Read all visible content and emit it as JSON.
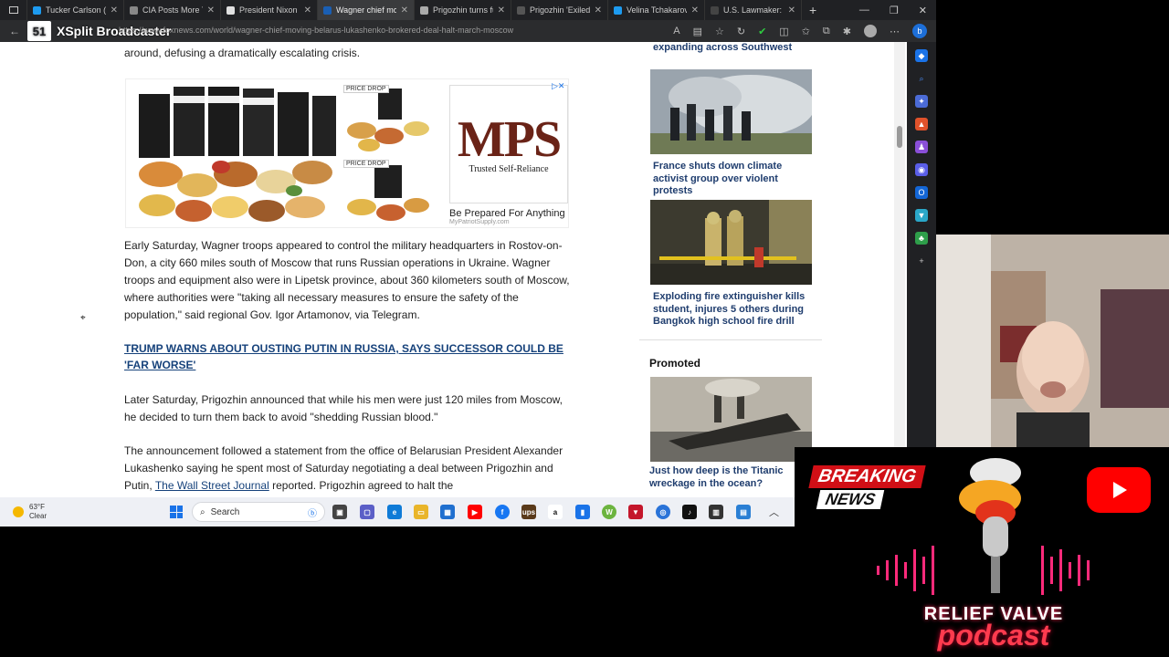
{
  "browser": {
    "tabs": [
      {
        "title": "Tucker Carlson (@",
        "color": "#1d9bf0"
      },
      {
        "title": "CIA Posts More Tr",
        "color": "#888888"
      },
      {
        "title": "President Nixon a",
        "color": "#e0e0e0"
      },
      {
        "title": "Wagner chief mo",
        "color": "#1a5fb4",
        "active": true
      },
      {
        "title": "Prigozhin turns fu",
        "color": "#aaaaaa"
      },
      {
        "title": "Prigozhin 'Exiled'",
        "color": "#333333"
      },
      {
        "title": "Velina Tchakarova",
        "color": "#1d9bf0"
      },
      {
        "title": "U.S. Lawmaker: P",
        "color": "#444444"
      }
    ],
    "new_tab": "+",
    "url": "https://www.foxnews.com/world/wagner-chief-moving-belarus-lukashenko-brokered-deal-halt-march-moscow",
    "overlay_app": "XSplit Broadcaster",
    "overlay_logo": "51"
  },
  "article": {
    "intro_tail": "around, defusing a dramatically escalating crisis.",
    "para1": "Early Saturday, Wagner troops appeared to control the military headquarters in Rostov-on-Don, a city 660 miles south of Moscow that runs Russian operations in Ukraine. Wagner troops and equipment also were in Lipetsk province, about 360 kilometers south of Moscow, where authorities were \"taking all necessary measures to ensure the safety of the population,\" said regional Gov. Igor Artamonov, via Telegram.",
    "headline_link": "TRUMP WARNS ABOUT OUSTING PUTIN IN RUSSIA, SAYS SUCCESSOR COULD BE 'FAR WORSE'",
    "para2": "Later Saturday, Prigozhin announced that while his men were just 120 miles from Moscow, he decided to turn them back to avoid \"shedding Russian blood.\"",
    "para3_before": "The announcement followed a statement from the office of Belarusian President Alexander Lukashenko saying he spent most of Saturday negotiating a deal between Prigozhin and Putin, ",
    "para3_link": "The Wall Street Journal",
    "para3_after": " reported. Prigozhin agreed to halt the"
  },
  "ad": {
    "price_drop_1": "PRICE DROP",
    "price_drop_2": "PRICE DROP",
    "logo_text": "MPS",
    "logo_tagline": "Trusted Self-Reliance",
    "caption": "Be Prepared For Anything",
    "sponsor": "MyPatriotSupply.com"
  },
  "sidebar_stories": {
    "top_tail": "expanding across Southwest",
    "story1": "France shuts down climate activist group over violent protests",
    "story2": "Exploding fire extinguisher kills student, injures 5 others during Bangkok high school fire drill",
    "promoted_label": "Promoted",
    "story3": "Just how deep is the Titanic wreckage in the ocean?"
  },
  "taskbar": {
    "temp": "63°F",
    "condition": "Clear",
    "search_placeholder": "Search"
  },
  "promo": {
    "breaking": "BREAKING",
    "news": "NEWS",
    "podcast_name": "RELIEF VALVE",
    "podcast_word": "podcast"
  }
}
